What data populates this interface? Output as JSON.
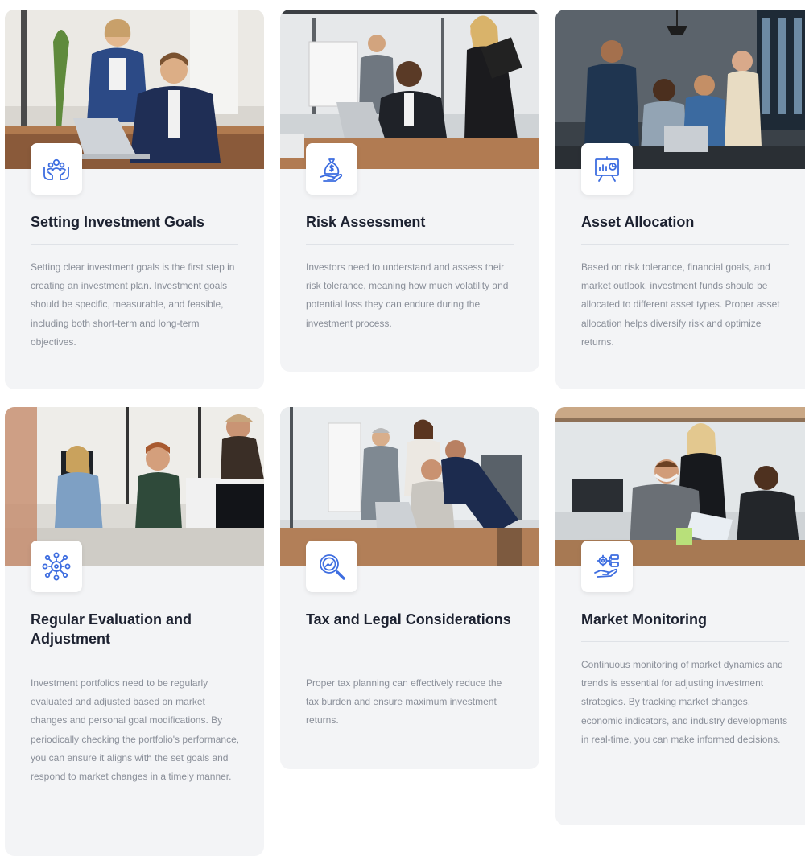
{
  "cards": [
    {
      "title": "Setting Investment Goals",
      "text": "Setting clear investment goals is the first step in creating an investment plan. Investment goals should be specific, measurable, and feasible, including both short-term and long-term objectives.",
      "icon": "team-in-hands-icon"
    },
    {
      "title": "Risk Assessment",
      "text": "Investors need to understand and assess their risk tolerance, meaning how much volatility and potential loss they can endure during the investment process.",
      "icon": "money-bag-in-hand-icon"
    },
    {
      "title": "Asset Allocation",
      "text": "Based on risk tolerance, financial goals, and market outlook, investment funds should be allocated to different asset types. Proper asset allocation helps diversify risk and optimize returns.",
      "icon": "presentation-board-icon"
    },
    {
      "title": "Regular Evaluation and Adjustment",
      "text": "Investment portfolios need to be regularly evaluated and adjusted based on market changes and personal goal modifications. By periodically checking the portfolio's performance, you can ensure it aligns with the set goals and respond to market changes in a timely manner.",
      "icon": "network-gear-icon"
    },
    {
      "title": "Tax and Legal Considerations",
      "text": "Proper tax planning can effectively reduce the tax burden and ensure maximum investment returns.",
      "icon": "magnifier-chart-icon"
    },
    {
      "title": "Market Monitoring",
      "text": "Continuous monitoring of market dynamics and trends is essential for adjusting investment strategies. By tracking market changes, economic indicators, and industry developments in real-time, you can make informed decisions.",
      "icon": "settings-hand-icon"
    }
  ],
  "colors": {
    "card_bg": "#f3f4f6",
    "title": "#1c2130",
    "body_text": "#8a8f99",
    "icon_accent": "#3d6de0"
  }
}
